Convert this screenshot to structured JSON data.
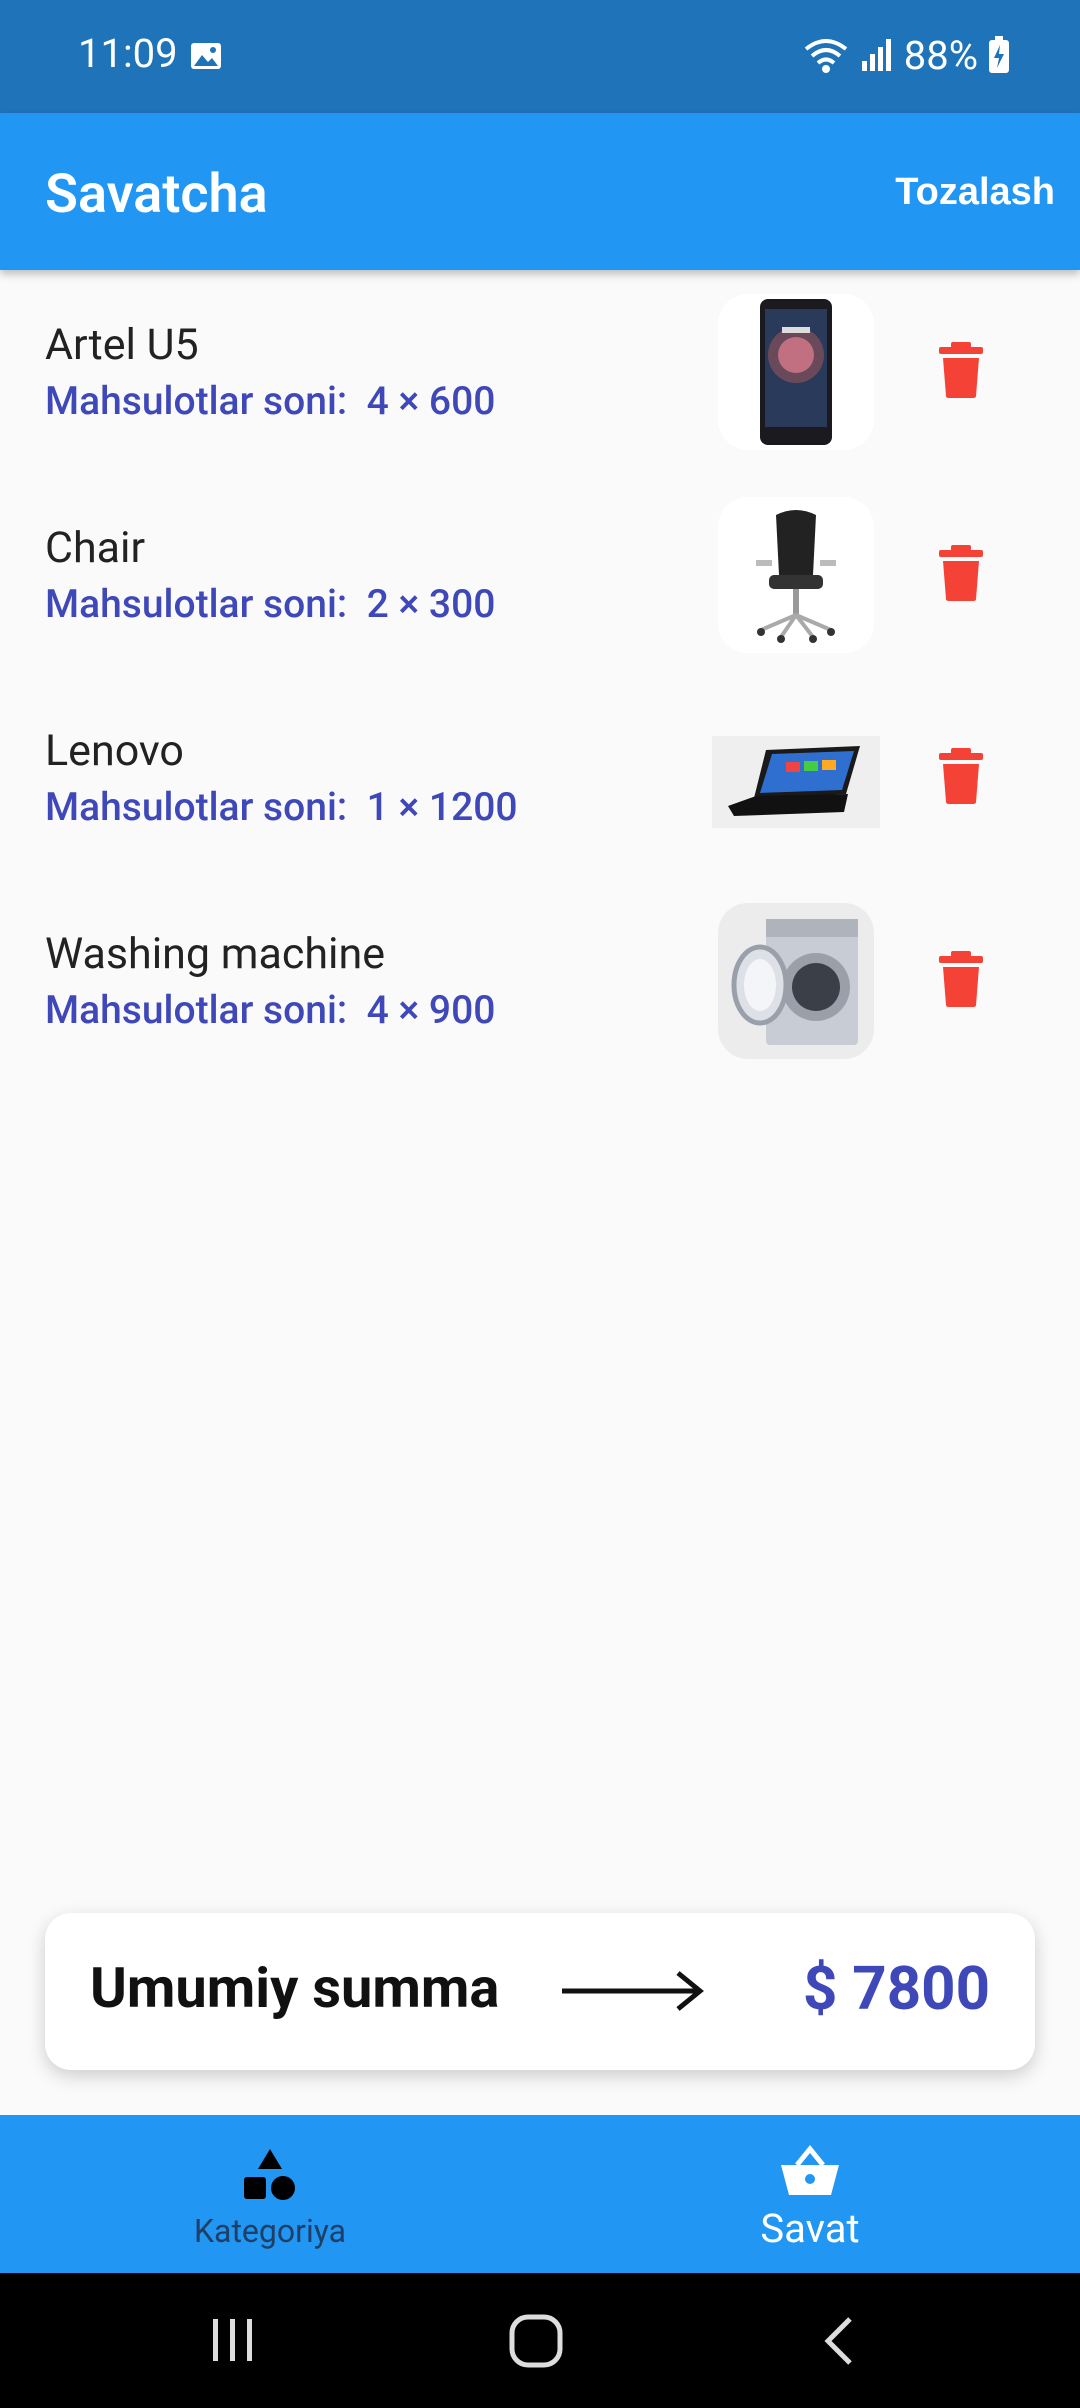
{
  "status_bar": {
    "time": "11:09",
    "battery_percent": "88%",
    "icons": [
      "gallery-icon",
      "wifi-icon",
      "signal-icon",
      "battery-charging-icon"
    ]
  },
  "app_bar": {
    "title": "Savatcha",
    "clear_label": "Tozalash"
  },
  "cart": {
    "qty_prefix": "Mahsulotlar soni:",
    "items": [
      {
        "name": "Artel U5",
        "quantity": 4,
        "price": 600,
        "qty_text": "4 × 600",
        "image": "phone"
      },
      {
        "name": "Chair",
        "quantity": 2,
        "price": 300,
        "qty_text": "2 × 300",
        "image": "chair"
      },
      {
        "name": "Lenovo",
        "quantity": 1,
        "price": 1200,
        "qty_text": "1 × 1200",
        "image": "laptop"
      },
      {
        "name": "Washing machine",
        "quantity": 4,
        "price": 900,
        "qty_text": "4 × 900",
        "image": "washing-machine"
      }
    ]
  },
  "total": {
    "label": "Umumiy summa",
    "value": "$ 7800"
  },
  "bottom_nav": {
    "items": [
      {
        "label": "Kategoriya",
        "icon": "category-icon",
        "active": false
      },
      {
        "label": "Savat",
        "icon": "basket-icon",
        "active": true
      }
    ]
  },
  "colors": {
    "primary": "#2196f3",
    "status_bar": "#1f73b8",
    "accent_text": "#3f48b8",
    "delete": "#f44336"
  }
}
